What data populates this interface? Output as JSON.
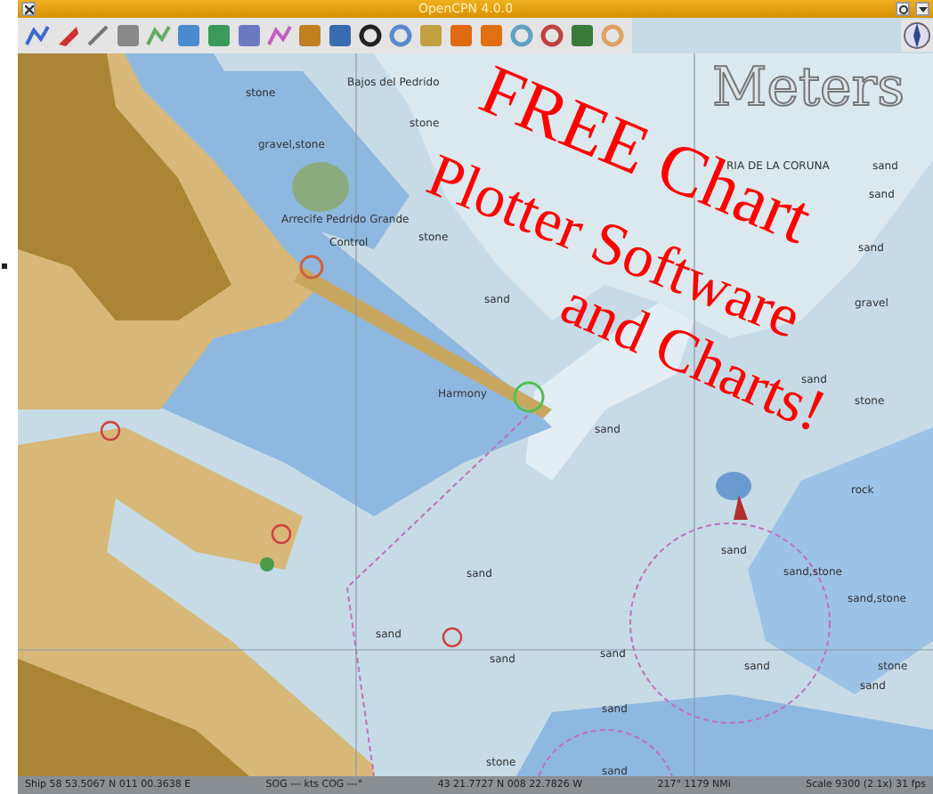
{
  "window": {
    "title": "OpenCPN 4.0.0"
  },
  "chart": {
    "units_label": "Meters",
    "labels": [
      {
        "text": "Bajos del Pedrido"
      },
      {
        "text": "stone"
      },
      {
        "text": "stone"
      },
      {
        "text": "gravel,stone"
      },
      {
        "text": "Arrecife Pedrido Grande"
      },
      {
        "text": "Control"
      },
      {
        "text": "stone"
      },
      {
        "text": "RIA DE LA CORUNA"
      },
      {
        "text": "sand"
      },
      {
        "text": "sand"
      },
      {
        "text": "sand"
      },
      {
        "text": "sand"
      },
      {
        "text": "sand"
      },
      {
        "text": "gravel"
      },
      {
        "text": "Harmony"
      },
      {
        "text": "stone"
      },
      {
        "text": "sand"
      },
      {
        "text": "rock"
      },
      {
        "text": "sand"
      },
      {
        "text": "sand,stone"
      },
      {
        "text": "sand,stone"
      },
      {
        "text": "sand"
      },
      {
        "text": "sand"
      },
      {
        "text": "sand"
      },
      {
        "text": "sand"
      },
      {
        "text": "sand"
      },
      {
        "text": "stone"
      },
      {
        "text": "sand"
      },
      {
        "text": "sand"
      },
      {
        "text": "stone"
      },
      {
        "text": "sand"
      }
    ]
  },
  "promo": [
    "FREE Chart",
    "Plotter Software",
    "and Charts!"
  ],
  "status_bar": [
    "Ship 58 53.5067 N 011 00.3638 E",
    "SOG --- kts COG ---°",
    "43 21.7727 N 008 22.7826 W",
    "217° 1179 NMi",
    "Scale 9300 (2.1x) 31 fps"
  ]
}
